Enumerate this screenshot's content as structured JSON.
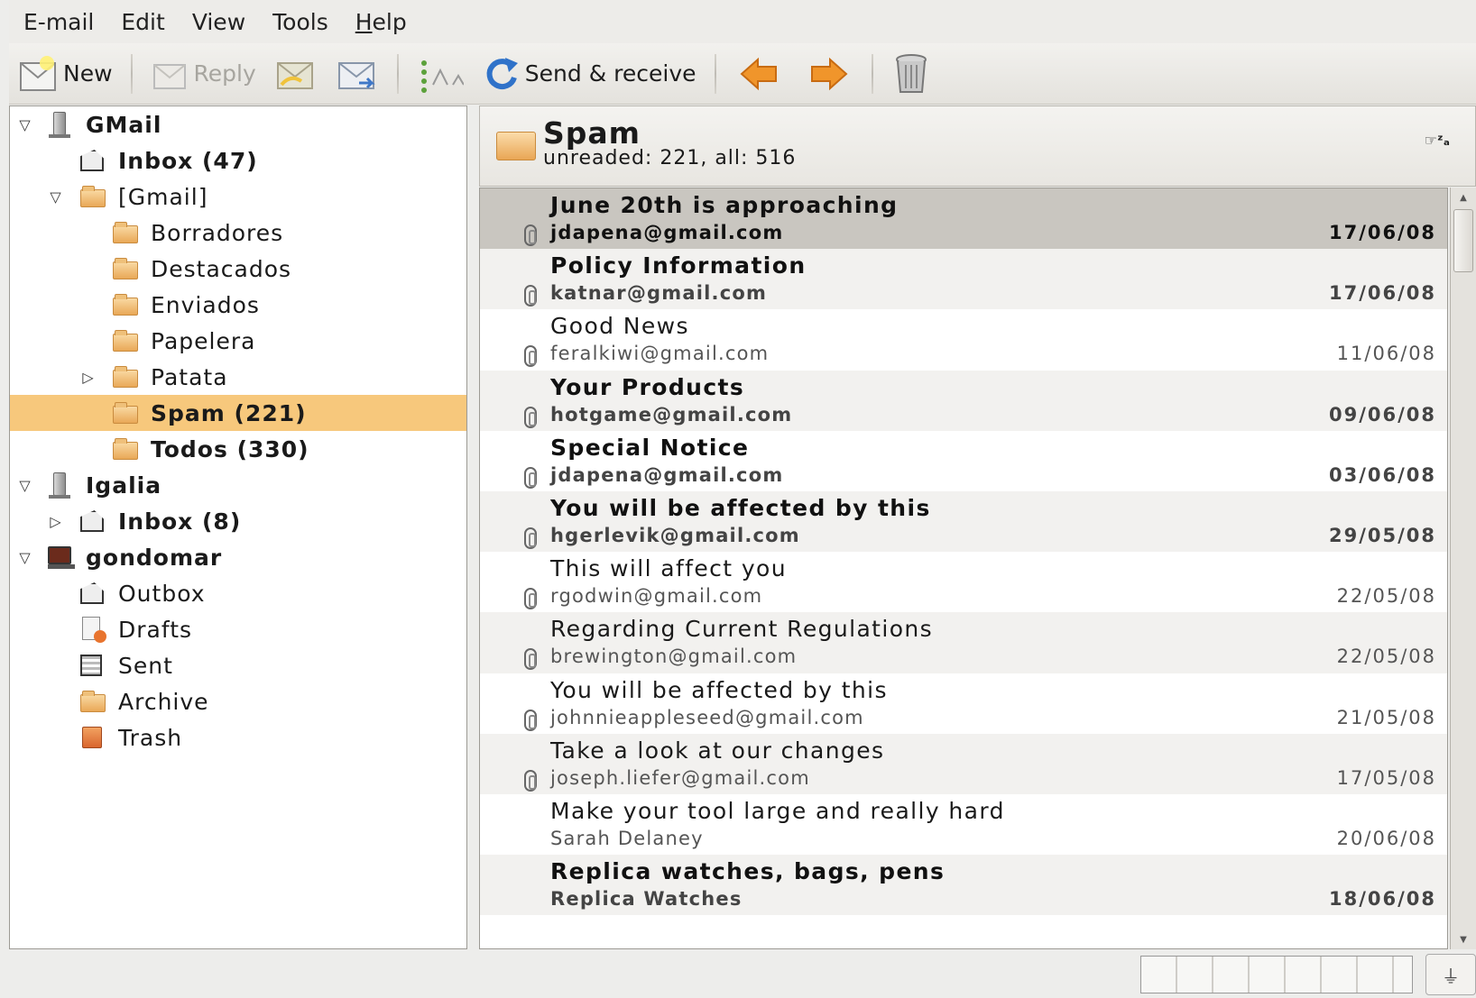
{
  "menu": [
    "E-mail",
    "Edit",
    "View",
    "Tools",
    "Help"
  ],
  "toolbar": {
    "new_label": "New",
    "reply_label": "Reply",
    "send_receive_label": "Send & receive"
  },
  "folders": {
    "gmail_account": "GMail",
    "gmail_inbox": "Inbox (47)",
    "gmail_group": "[Gmail]",
    "borradores": "Borradores",
    "destacados": "Destacados",
    "enviados": "Enviados",
    "papelera": "Papelera",
    "patata": "Patata",
    "spam": "Spam (221)",
    "todos": "Todos (330)",
    "igalia_account": "Igalia",
    "igalia_inbox": "Inbox (8)",
    "local_account": "gondomar",
    "outbox": "Outbox",
    "drafts": "Drafts",
    "sent": "Sent",
    "archive": "Archive",
    "trash": "Trash"
  },
  "header": {
    "folder_name": "Spam",
    "counts": "unreaded: 221, all: 516"
  },
  "messages": [
    {
      "subject": "June 20th is approaching",
      "from": "jdapena@gmail.com",
      "date": "17/06/08",
      "unread": true,
      "attachment": true,
      "selected": true
    },
    {
      "subject": "Policy Information",
      "from": "katnar@gmail.com",
      "date": "17/06/08",
      "unread": true,
      "attachment": true
    },
    {
      "subject": "Good News",
      "from": "feralkiwi@gmail.com",
      "date": "11/06/08",
      "unread": false,
      "attachment": true
    },
    {
      "subject": "Your Products",
      "from": "hotgame@gmail.com",
      "date": "09/06/08",
      "unread": true,
      "attachment": true
    },
    {
      "subject": "Special Notice",
      "from": "jdapena@gmail.com",
      "date": "03/06/08",
      "unread": true,
      "attachment": true
    },
    {
      "subject": "You will be affected by this",
      "from": "hgerlevik@gmail.com",
      "date": "29/05/08",
      "unread": true,
      "attachment": true
    },
    {
      "subject": "This will affect you",
      "from": "rgodwin@gmail.com",
      "date": "22/05/08",
      "unread": false,
      "attachment": true
    },
    {
      "subject": "Regarding Current Regulations",
      "from": "brewington@gmail.com",
      "date": "22/05/08",
      "unread": false,
      "attachment": true
    },
    {
      "subject": "You will be affected by this",
      "from": "johnnieappleseed@gmail.com",
      "date": "21/05/08",
      "unread": false,
      "attachment": true
    },
    {
      "subject": "Take a look at our changes",
      "from": "joseph.liefer@gmail.com",
      "date": "17/05/08",
      "unread": false,
      "attachment": true
    },
    {
      "subject": "Make your tool large and really hard",
      "from": "Sarah Delaney",
      "date": "20/06/08",
      "unread": false,
      "attachment": false
    },
    {
      "subject": "Replica watches, bags, pens",
      "from": "Replica Watches",
      "date": "18/06/08",
      "unread": true,
      "attachment": false
    }
  ],
  "colors": {
    "selected_folder": "#f7c87c",
    "selected_message": "#c9c6c0",
    "folder_icon": "#e9a857",
    "arrow_icon": "#f0952b",
    "send_receive_icon": "#2f72c9"
  },
  "icons": {
    "new": "new-mail-icon",
    "reply": "reply-icon",
    "reply_all": "reply-all-icon",
    "forward": "forward-icon",
    "move": "move-to-folder-icon",
    "send_receive": "refresh-icon",
    "prev": "arrow-left-icon",
    "next": "arrow-right-icon",
    "delete": "trash-icon",
    "sort": "sort-icon",
    "connection": "connection-plug-icon"
  }
}
